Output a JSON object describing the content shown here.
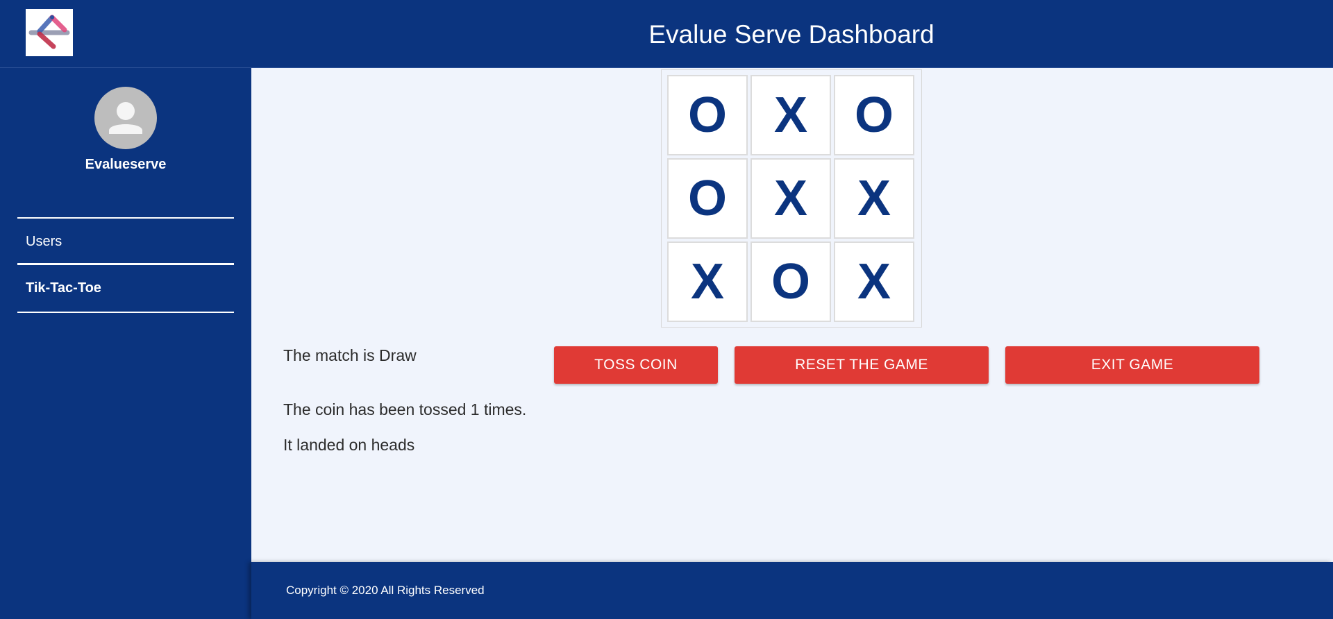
{
  "header": {
    "logo": "evalueserve-logo",
    "title": "Evalue Serve Dashboard"
  },
  "sidebar": {
    "avatar_icon": "person-icon",
    "username": "Evalueserve",
    "items": [
      {
        "label": "Users",
        "active": false
      },
      {
        "label": "Tik-Tac-Toe",
        "active": true
      }
    ]
  },
  "game": {
    "board": [
      "O",
      "X",
      "O",
      "O",
      "X",
      "X",
      "X",
      "O",
      "X"
    ],
    "result": "The match is Draw",
    "toss_count_text": "The coin has been tossed 1 times.",
    "toss_result_text": "It landed on heads",
    "buttons": {
      "toss": "TOSS COIN",
      "reset": "RESET THE GAME",
      "exit": "EXIT GAME"
    }
  },
  "footer": {
    "copyright": "Copyright © 2020 All Rights Reserved"
  },
  "colors": {
    "primary": "#0b347f",
    "button": "#e03a35",
    "background": "#f0f4fc"
  }
}
